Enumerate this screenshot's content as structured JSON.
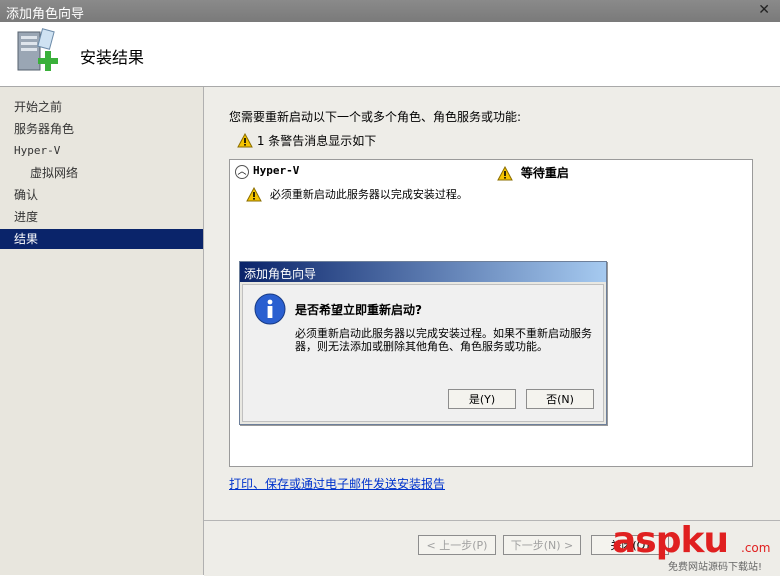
{
  "window": {
    "title": "添加角色向导",
    "close": "✕"
  },
  "header": {
    "title": "安装结果"
  },
  "sidebar": {
    "items": [
      {
        "label": "开始之前"
      },
      {
        "label": "服务器角色"
      },
      {
        "label": "Hyper-V"
      },
      {
        "label": "虚拟网络"
      },
      {
        "label": "确认"
      },
      {
        "label": "进度"
      },
      {
        "label": "结果"
      }
    ],
    "active": "结果"
  },
  "main": {
    "intro": "您需要重新启动以下一个或多个角色、角色服务或功能:",
    "warning_summary": "1 条警告消息显示如下",
    "results": {
      "role": "Hyper-V",
      "status": "等待重启",
      "message": "必须重新启动此服务器以完成安装过程。"
    },
    "report_link": "打印、保存或通过电子邮件发送安装报告"
  },
  "footer": {
    "prev": "< 上一步(P)",
    "next": "下一步(N) >",
    "close": "关闭(O)"
  },
  "dialog": {
    "title": "添加角色向导",
    "question": "是否希望立即重新启动?",
    "message": "必须重新启动此服务器以完成安装过程。如果不重新启动服务器，则无法添加或删除其他角色、角色服务或功能。",
    "yes": "是(Y)",
    "no": "否(N)"
  },
  "watermark": {
    "brand": "aspku",
    "tld": ".com",
    "tagline": "免费网站源码下载站!"
  },
  "colors": {
    "active_nav": "#0a246a",
    "link": "#0033cc",
    "warning": "#f5c400",
    "info": "#2a5fd0"
  }
}
